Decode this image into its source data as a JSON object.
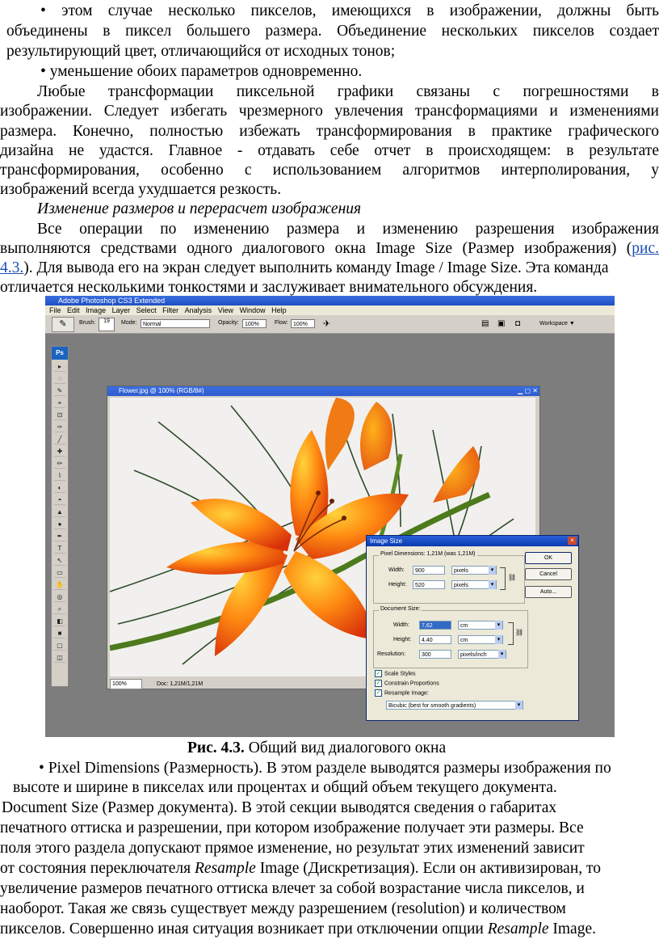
{
  "top_text": {
    "line1": "• этом случае несколько пикселов, имеющихся в изображении, должны быть",
    "line2": "объединены в пиксел большего размера. Объединение нескольких пикселов создает",
    "line3": "результирующий цвет, отличающийся от исходных тонов;",
    "line4": "• уменьшение обоих параметров одновременно.",
    "para2_line1": "Любые трансформации пиксельной графики связаны с погрешностями в",
    "para2_line2": "изображении. Следует избегать чрезмерного увлечения трансформациями и изменениями",
    "para2_line3": "размера. Конечно, полностью избежать трансформирования в практике графического",
    "para2_line4": "дизайна не удастся. Главное - отдавать себе отчет в происходящем: в результате",
    "para2_line5": "трансформирования, особенно с использованием алгоритмов интерполирования, у",
    "para2_line6": "изображений всегда ухудшается резкость.",
    "subheading": "Изменение размеров и перерасчет изображения",
    "para3_line1": "Все операции по изменению размера и изменению разрешения изображения",
    "para3_line2_pre": "выполняются средствами одного диалогового окна Image Size (Размер изображения) (",
    "para3_line2_link": "рис.",
    "para3_line3_link": "4.3.",
    "para3_line3_post": "). Для вывода его на экран следует выполнить команду Image / Image Size. Эта команда",
    "para3_line4": "отличается несколькими тонкостями и заслуживает внимательного обсуждения."
  },
  "figure": {
    "app_title": "Adobe Photoshop CS3 Extended",
    "menu": [
      "File",
      "Edit",
      "Image",
      "Layer",
      "Select",
      "Filter",
      "Analysis",
      "View",
      "Window",
      "Help"
    ],
    "options": {
      "brush_label": "Brush:",
      "brush_size": "19",
      "mode_label": "Mode:",
      "mode_value": "Normal",
      "opacity_label": "Opacity:",
      "opacity_value": "100%",
      "flow_label": "Flow:",
      "flow_value": "100%",
      "workspace": "Workspace ▼"
    },
    "tools_logo": "Ps",
    "tools": [
      "▸",
      "◌",
      "✎",
      "⌖",
      "⊡",
      "✑",
      "╱",
      "✚",
      "✏",
      "⌇",
      "◐",
      "◓",
      "▲",
      "●",
      "✒",
      "T",
      "↖",
      "▭",
      "✋",
      "◎",
      "⌕",
      "◧",
      "■",
      "▢",
      "◫"
    ],
    "document": {
      "title": "Flower.jpg @ 100% (RGB/8#)",
      "status_zoom": "100%",
      "status_doc": "Doc: 1,21M/1,21M"
    },
    "dialog": {
      "title": "Image Size",
      "close": "×",
      "pixel_dims_label": "Pixel Dimensions:  1,21M (was 1,21M)",
      "width_label": "Width:",
      "width_value": "900",
      "width_unit": "pixels",
      "height_label": "Height:",
      "height_value": "520",
      "height_unit": "pixels",
      "doc_size_label": "Document Size:",
      "doc_width_label": "Width:",
      "doc_width_value": "7,62",
      "doc_width_unit": "cm",
      "doc_height_label": "Height:",
      "doc_height_value": "4,40",
      "doc_height_unit": "cm",
      "resolution_label": "Resolution:",
      "resolution_value": "300",
      "resolution_unit": "pixels/inch",
      "ok": "OK",
      "cancel": "Cancel",
      "auto": "Auto...",
      "scale_styles": "Scale Styles",
      "constrain": "Constrain Proportions",
      "resample": "Resample Image:",
      "resample_method": "Bicubic (best for smooth gradients)",
      "check_mark": "✓"
    }
  },
  "caption": {
    "bold": "Рис. 4.3.",
    "text": " Общий вид диалогового окна"
  },
  "bottom_text": {
    "line1": "• Pixel Dimensions (Размерность). В этом разделе выводятся размеры изображения по",
    "line2": "высоте и ширине в пикселах или процентах и общий объем текущего документа.",
    "line3": "Document Size (Размер документа). В этой секции выводятся сведения о габаритах",
    "line4": "печатного оттиска и разрешении, при котором изображение получает эти размеры. Все",
    "line5": "поля этого раздела допускают прямое изменение, но результат этих изменений зависит",
    "line6_pre": "от состояния переключателя ",
    "line6_ital": "Resample",
    "line6_post": " Image (Дискретизация). Если он активизирован, то",
    "line7": "увеличение размеров печатного оттиска влечет за собой возрастание числа пикселов, и",
    "line8": "наоборот. Такая же связь существует между разрешением (resolution) и количеством",
    "line9_pre": "пикселов. Совершенно иная ситуация возникает при отключении опции ",
    "line9_ital": "Resample",
    "line9_post": " Image."
  }
}
